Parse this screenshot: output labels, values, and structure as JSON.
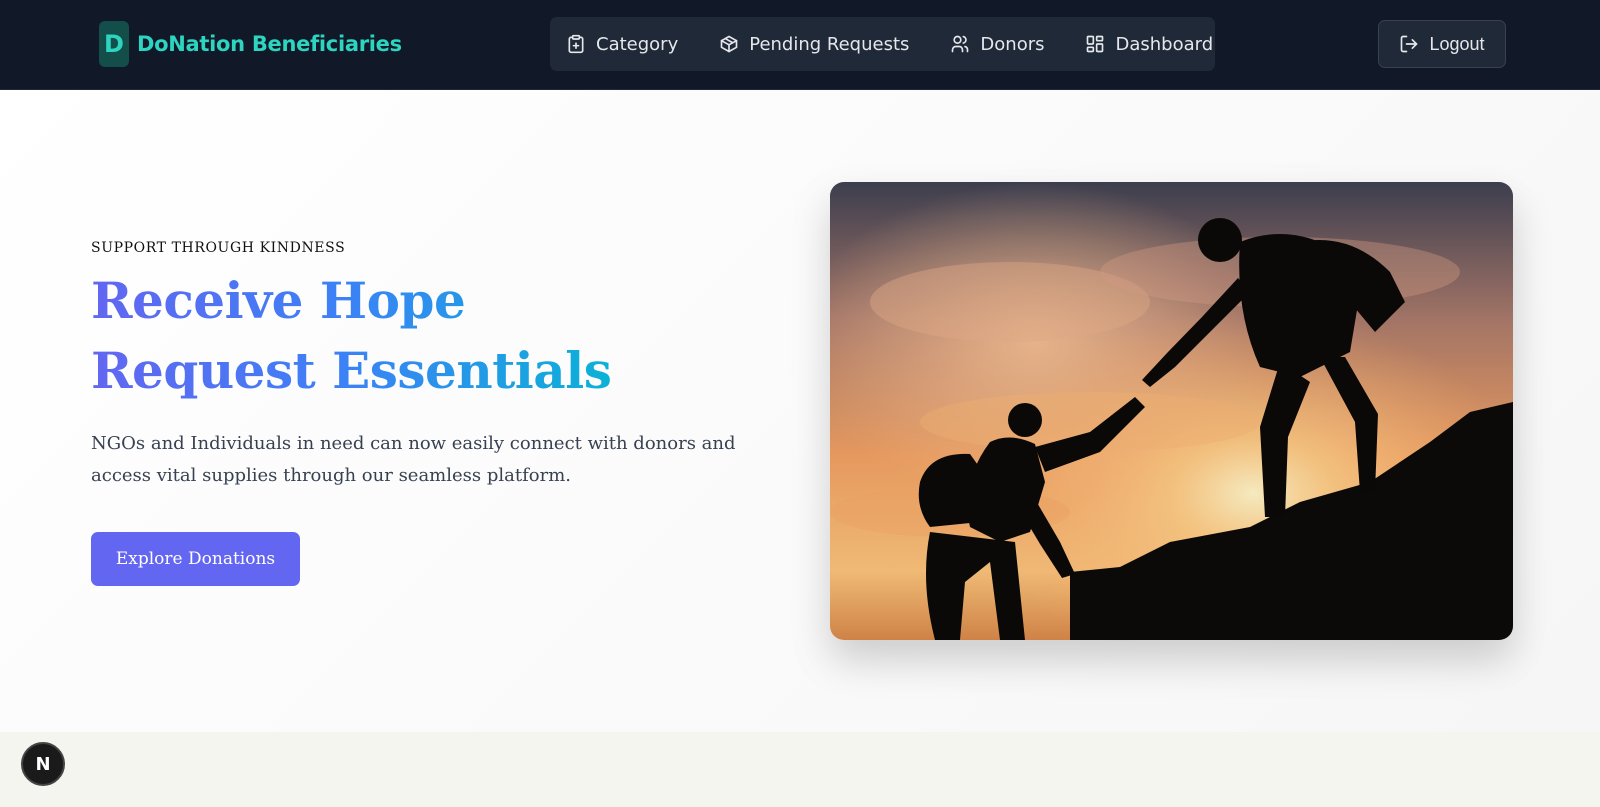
{
  "brand": {
    "logo_letter": "D",
    "name": "DoNation Beneficiaries"
  },
  "nav": {
    "items": [
      {
        "label": "Category",
        "icon": "clipboard-plus-icon"
      },
      {
        "label": "Pending Requests",
        "icon": "package-icon"
      },
      {
        "label": "Donors",
        "icon": "users-icon"
      },
      {
        "label": "Dashboard",
        "icon": "layout-grid-icon"
      }
    ],
    "logout_label": "Logout"
  },
  "hero": {
    "eyebrow": "SUPPORT THROUGH KINDNESS",
    "headline_line1": "Receive Hope",
    "headline_line2": "Request Essentials",
    "lead": "NGOs and Individuals in need can now easily connect with donors and access vital supplies through our seamless platform.",
    "cta_label": "Explore Donations"
  },
  "dev_badge": {
    "label": "N"
  },
  "colors": {
    "nav_bg": "#111827",
    "brand_accent": "#2dd4bf",
    "gradient_start": "#6366f1",
    "gradient_end": "#06b6d4",
    "cta_bg": "#6366f1"
  }
}
